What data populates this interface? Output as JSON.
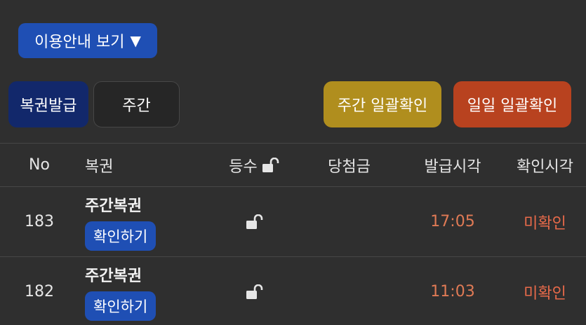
{
  "guide": {
    "label": "이용안내 보기",
    "arrow": "▼"
  },
  "tabs": {
    "issue": "복권발급",
    "weekly": "주간"
  },
  "actions": {
    "weekly_confirm": "주간 일괄확인",
    "daily_confirm": "일일 일괄확인"
  },
  "table": {
    "headers": {
      "no": "No",
      "ticket": "복권",
      "rank": "등수",
      "prize": "당첨금",
      "issue_time": "발급시각",
      "confirm_time": "확인시각"
    },
    "rows": [
      {
        "no": "183",
        "ticket": "주간복권",
        "action": "확인하기",
        "issue_time": "17:05",
        "confirm_time": "미확인"
      },
      {
        "no": "182",
        "ticket": "주간복권",
        "action": "확인하기",
        "issue_time": "11:03",
        "confirm_time": "미확인"
      }
    ]
  },
  "icons": {
    "lock": "unlock-icon"
  },
  "colors": {
    "primary": "#1f4fb4",
    "weekly": "#b08e1e",
    "daily": "#b8421f",
    "time": "#e07a55"
  }
}
